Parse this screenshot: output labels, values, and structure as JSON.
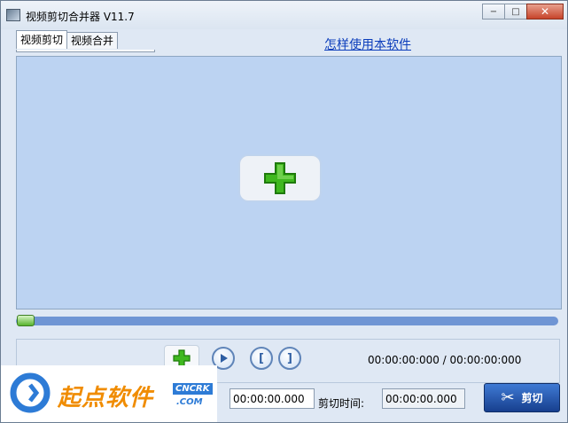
{
  "window": {
    "title": "视频剪切合并器 V11.7",
    "controls": {
      "minimize": "−",
      "maximize": "□",
      "close": "✕"
    }
  },
  "tabs": [
    {
      "label": "视频剪切"
    },
    {
      "label": "视频合并"
    }
  ],
  "help_link": "怎样使用本软件",
  "playback": {
    "progress_fraction": 0.0,
    "time_display": "00:00:00:000 / 00:00:00:000",
    "buttons": {
      "add": "add-icon",
      "play": "play-icon",
      "mark_in": "[",
      "mark_out": "]"
    }
  },
  "cut": {
    "start_time_value": "00:00:00.000",
    "duration_label": "剪切时间:",
    "duration_value": "00:00:00.000",
    "cut_button_label": "剪切",
    "cut_button_icon": "scissors-icon"
  },
  "watermark": {
    "brand_text": "起点软件",
    "badge": "CNCRK",
    "domain": ".COM"
  },
  "colors": {
    "preview_bg": "#bcd3f2",
    "progress_track": "#6f95d4",
    "progress_thumb": "#57b32e",
    "cut_button": "#1d4da6",
    "link": "#0b3dbb",
    "brand_orange": "#f08c00",
    "brand_blue": "#2d7bd6"
  }
}
